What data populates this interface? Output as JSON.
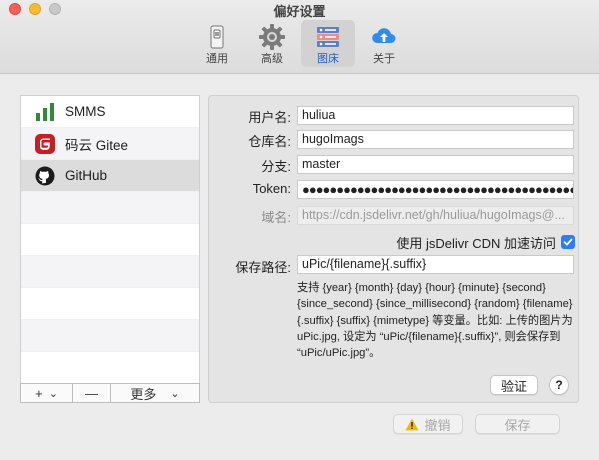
{
  "window": {
    "title": "偏好设置"
  },
  "toolbar": {
    "tabs": [
      {
        "label": "通用",
        "icon": "switch-icon",
        "active": false
      },
      {
        "label": "高级",
        "icon": "gear-icon",
        "active": false
      },
      {
        "label": "图床",
        "icon": "image-host-icon",
        "active": true
      },
      {
        "label": "关于",
        "icon": "cloud-upload-icon",
        "active": false
      }
    ]
  },
  "sidebar": {
    "items": [
      {
        "label": "SMMS",
        "icon": "bar-chart-icon",
        "selected": false
      },
      {
        "label": "码云 Gitee",
        "icon": "gitee-icon",
        "selected": false
      },
      {
        "label": "GitHub",
        "icon": "github-icon",
        "selected": true
      }
    ],
    "add_label": "+",
    "add_menu_icon": "⌄",
    "remove_label": "—",
    "more_label": "更多",
    "more_menu_icon": "⌄"
  },
  "form": {
    "username": {
      "label": "用户名:",
      "value": "huliua"
    },
    "repo": {
      "label": "仓库名:",
      "value": "hugoImags"
    },
    "branch": {
      "label": "分支:",
      "value": "master"
    },
    "token": {
      "label": "Token:",
      "value": "●●●●●●●●●●●●●●●●●●●●●●●●●●●●●●●●●●●●●●●●●●●●●●●..."
    },
    "domain": {
      "label": "域名:",
      "value": "https://cdn.jsdelivr.net/gh/huliua/hugoImags@..."
    },
    "jsdelivr": {
      "label": "使用 jsDelivr CDN 加速访问",
      "checked": true
    },
    "save_path": {
      "label": "保存路径:",
      "value": "uPic/{filename}{.suffix}"
    },
    "help_text": "支持 {year} {month} {day} {hour} {minute} {second} {since_second} {since_millisecond} {random} {filename} {.suffix} {suffix} {mimetype} 等变量。比如: 上传的图片为 uPic.jpg, 设定为 “uPic/{filename}{.suffix}”, 则会保存到 “uPic/uPic.jpg”。",
    "verify_label": "验证",
    "help_label": "?"
  },
  "footer": {
    "cancel_label": "撤销",
    "save_label": "保存"
  },
  "colors": {
    "accent": "#2f7df6",
    "gitee_red": "#c71d23",
    "smms_green": "#2e8b3a",
    "warning": "#f5b800"
  }
}
